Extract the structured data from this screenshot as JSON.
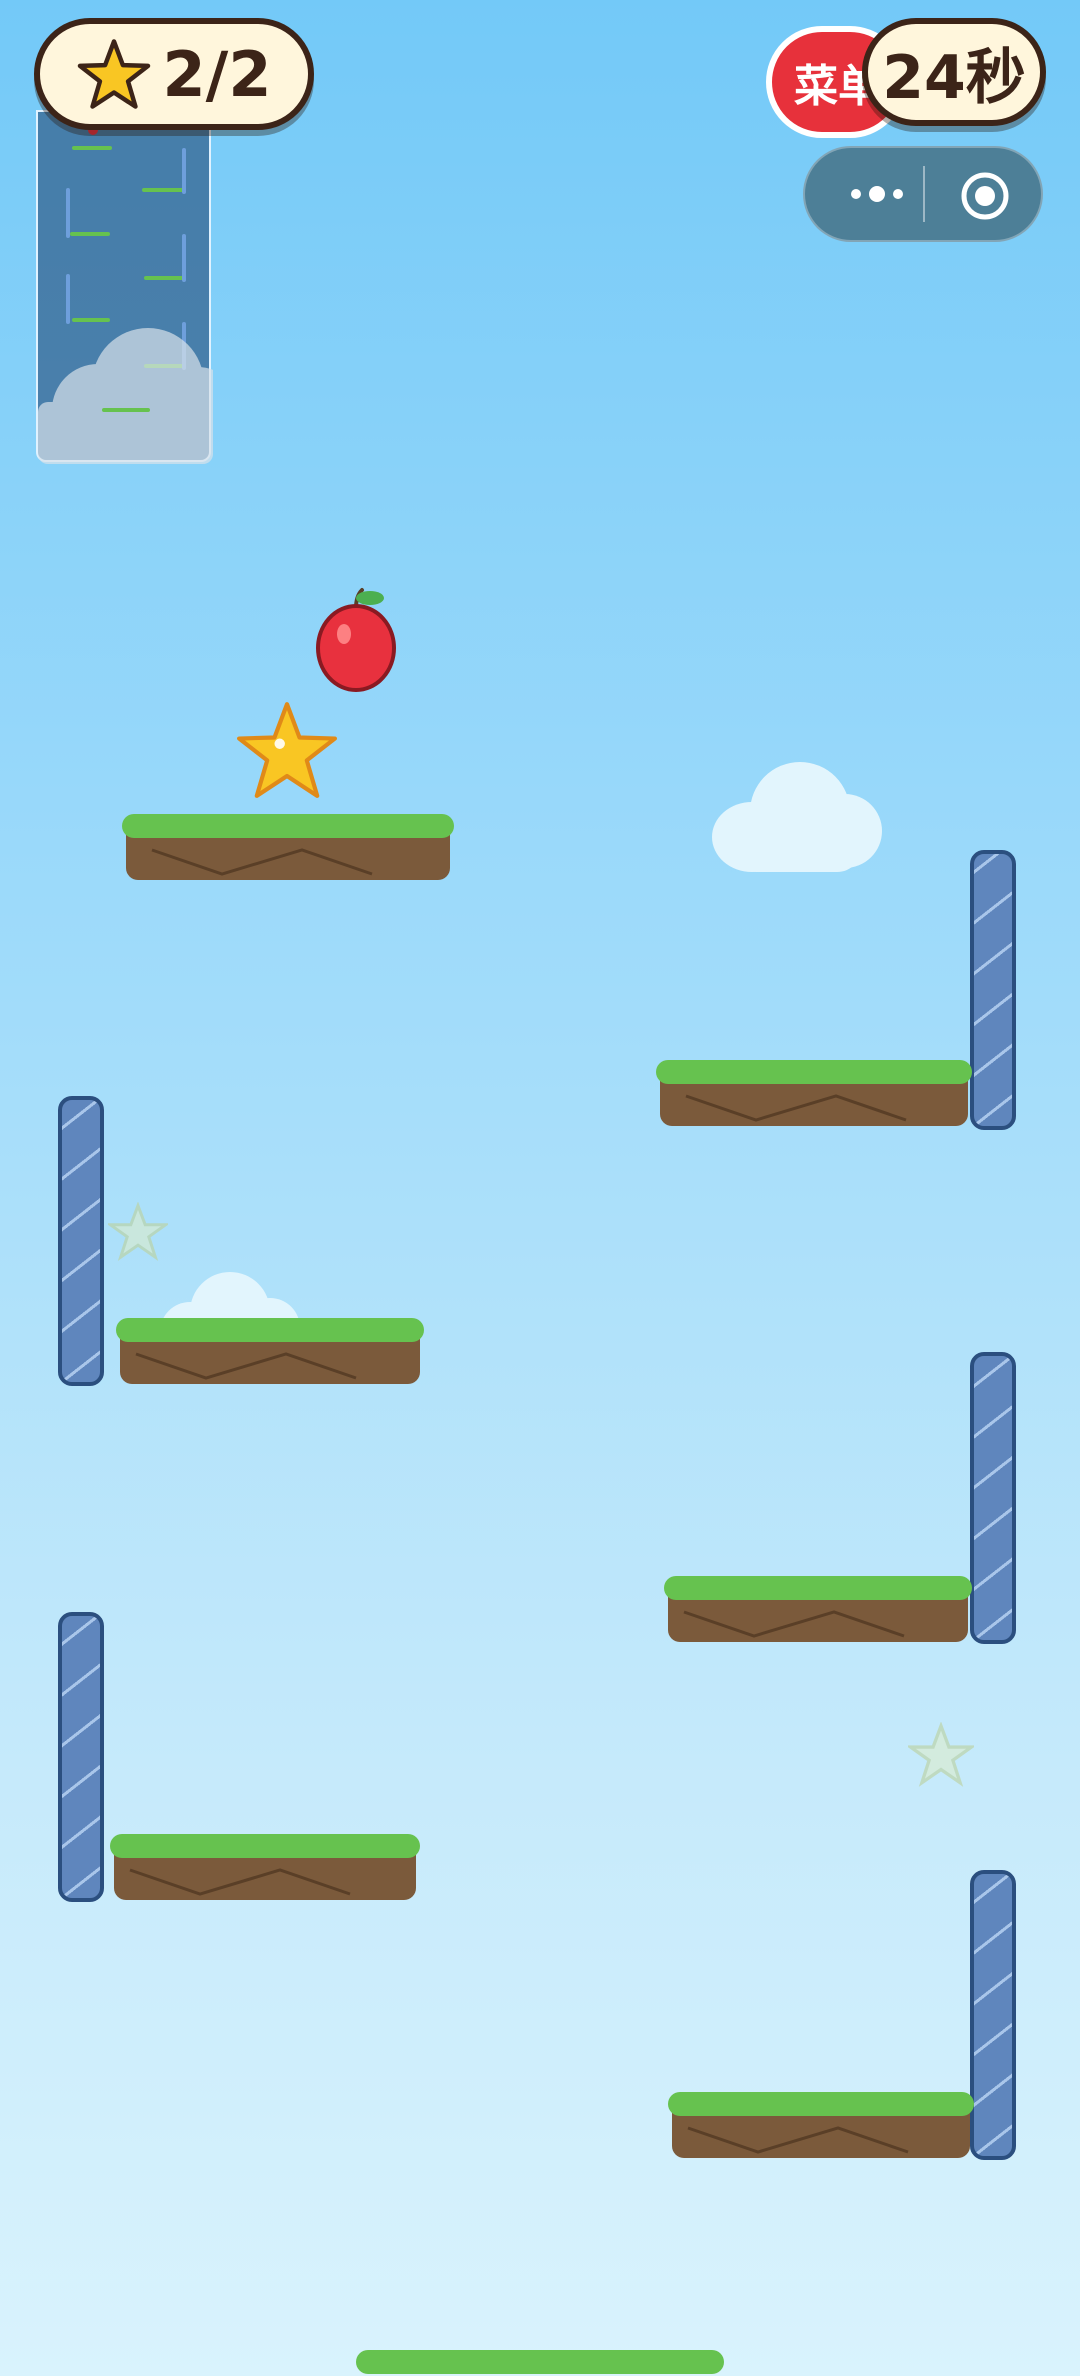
{
  "hud": {
    "score_text": "2/2",
    "timer_text": "24秒",
    "menu_label": "菜单"
  },
  "icons": {
    "score": "star-icon",
    "capsule_more": "more-dots-icon",
    "capsule_close": "target-circle-icon"
  },
  "colors": {
    "sky_top": "#73c9f8",
    "sky_bottom": "#d9f3fd",
    "grass": "#66c24f",
    "dirt": "#7b5a3b",
    "wall": "#5f86bd",
    "menu_red": "#e7313b",
    "star_gold": "#f9c623",
    "apple_red": "#e8313e"
  },
  "game": {
    "stars_collected": 2,
    "stars_total": 2,
    "time_remaining_seconds": 24,
    "collected_star_ghosts": 2
  }
}
